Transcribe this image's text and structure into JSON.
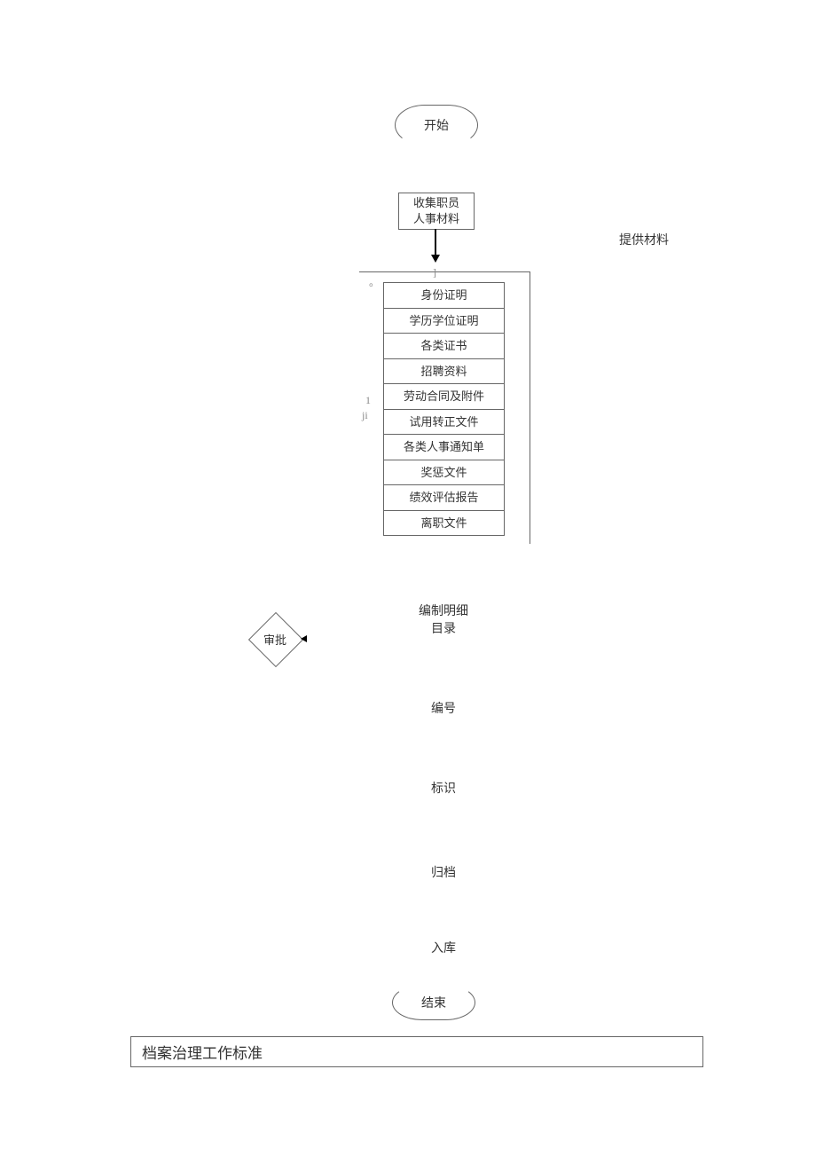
{
  "start": "开始",
  "collect": {
    "line1": "收集职员",
    "line2": "人事材料"
  },
  "provide": "提供材料",
  "list_items": [
    "身份证明",
    "学历学位证明",
    "各类证书",
    "招聘资料",
    "劳动合同及附件",
    "试用转正文件",
    "各类人事通知单",
    "奖惩文件",
    "绩效评估报告",
    "离职文件"
  ],
  "approve": "审批",
  "steps": {
    "catalog_l1": "编制明细",
    "catalog_l2": "目录",
    "number": "编号",
    "mark": "标识",
    "archive": "归档",
    "storage": "入库"
  },
  "end": "结束",
  "footer": "档案治理工作标准",
  "marks": {
    "dot": "。",
    "bracket": "]",
    "one": "1",
    "ji": "ji"
  }
}
